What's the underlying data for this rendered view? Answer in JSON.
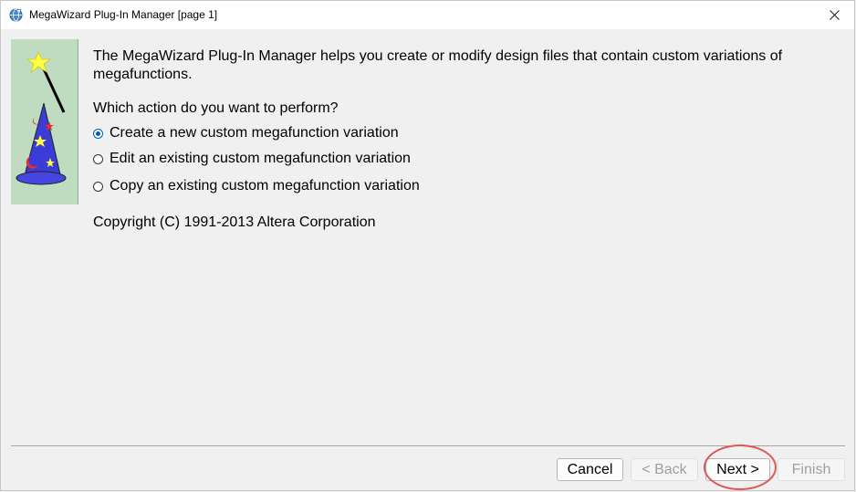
{
  "window": {
    "title": "MegaWizard Plug-In Manager [page 1]"
  },
  "main": {
    "intro": "The MegaWizard Plug-In Manager helps you create or modify design files that contain custom variations of megafunctions.",
    "question": "Which action do you want to perform?",
    "options": [
      {
        "label": "Create a new custom megafunction variation",
        "checked": true
      },
      {
        "label": "Edit an existing custom megafunction variation",
        "checked": false
      },
      {
        "label": "Copy an existing custom megafunction variation",
        "checked": false
      }
    ],
    "copyright": "Copyright (C) 1991-2013 Altera Corporation"
  },
  "footer": {
    "cancel_label": "Cancel",
    "back_label": "< Back",
    "next_label": "Next >",
    "finish_label": "Finish"
  },
  "colors": {
    "accent": "#005fb8",
    "wizard_bg": "#c0dcc0",
    "highlight": "#e05555"
  }
}
